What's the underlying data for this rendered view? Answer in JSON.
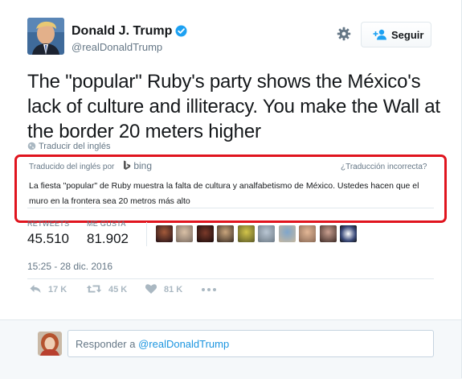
{
  "author": {
    "display_name": "Donald J. Trump",
    "handle": "@realDonaldTrump",
    "verified": true
  },
  "header": {
    "settings_icon": "gear-icon",
    "follow_icon": "add-user-icon",
    "follow_label": "Seguir"
  },
  "tweet": {
    "text": "The \"popular\" Ruby's party shows the México's lack of culture and illiteracy. You make the Wall at the border 20 meters higher",
    "translate_link": "Traducir del inglés"
  },
  "translation": {
    "label": "Traducido del inglés por",
    "provider": "bing",
    "wrong_link": "¿Traducción incorrecta?",
    "text": "La fiesta \"popular\" de Ruby muestra la falta de cultura y analfabetismo de México. Ustedes hacen que el muro en la frontera sea 20 metros más alto",
    "highlight_color": "#e0141e"
  },
  "stats": {
    "retweets_label": "RETWEETS",
    "retweets_value": "45.510",
    "likes_label": "ME GUSTA",
    "likes_value": "81.902"
  },
  "timestamp": "15:25 - 28 dic. 2016",
  "actions": {
    "reply_count": "17 K",
    "retweet_count": "45 K",
    "like_count": "81 K"
  },
  "reply": {
    "prefix": "Responder a",
    "mention": "@realDonaldTrump"
  },
  "colors": {
    "link_blue": "#1b95e0",
    "verified_blue": "#1da1f2",
    "muted": "#657786"
  }
}
